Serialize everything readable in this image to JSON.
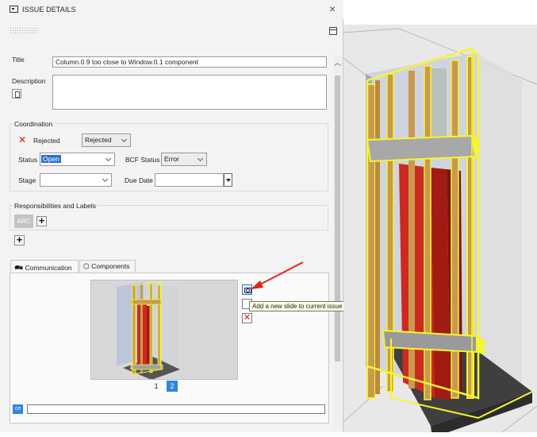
{
  "window": {
    "title": "ISSUE DETAILS",
    "close_glyph": "×"
  },
  "issue": {
    "title_label": "Title",
    "title_value": "Column.0.9 too close to Window.0.1 component",
    "description_label": "Description",
    "description_value": ""
  },
  "coordination": {
    "group_label": "Coordination",
    "status_flag_label": "Rejected",
    "status_flag_select": "Rejected",
    "status_label": "Status",
    "status_value": "Open",
    "bcf_status_label": "BCF Status",
    "bcf_status_value": "Error",
    "stage_label": "Stage",
    "stage_value": "",
    "due_date_label": "Due Date",
    "due_date_value": ""
  },
  "responsibilities": {
    "group_label": "Responsibilities and Labels",
    "chip": "ARC",
    "add_glyph": "+"
  },
  "tabs": [
    {
      "label": "Communication",
      "active": true
    },
    {
      "label": "Components",
      "active": false
    }
  ],
  "slides": {
    "pages": [
      "1",
      "2"
    ],
    "current": "2",
    "tooltip": "Add a new slide to current issue"
  },
  "comment": {
    "avatar": "ce",
    "value": ""
  },
  "colors": {
    "accent": "#2f86d9",
    "highlight": "#f5f531",
    "wall_red": "#cc2a1e",
    "reject_red": "#dd1111",
    "wood": "#c99a4e"
  }
}
